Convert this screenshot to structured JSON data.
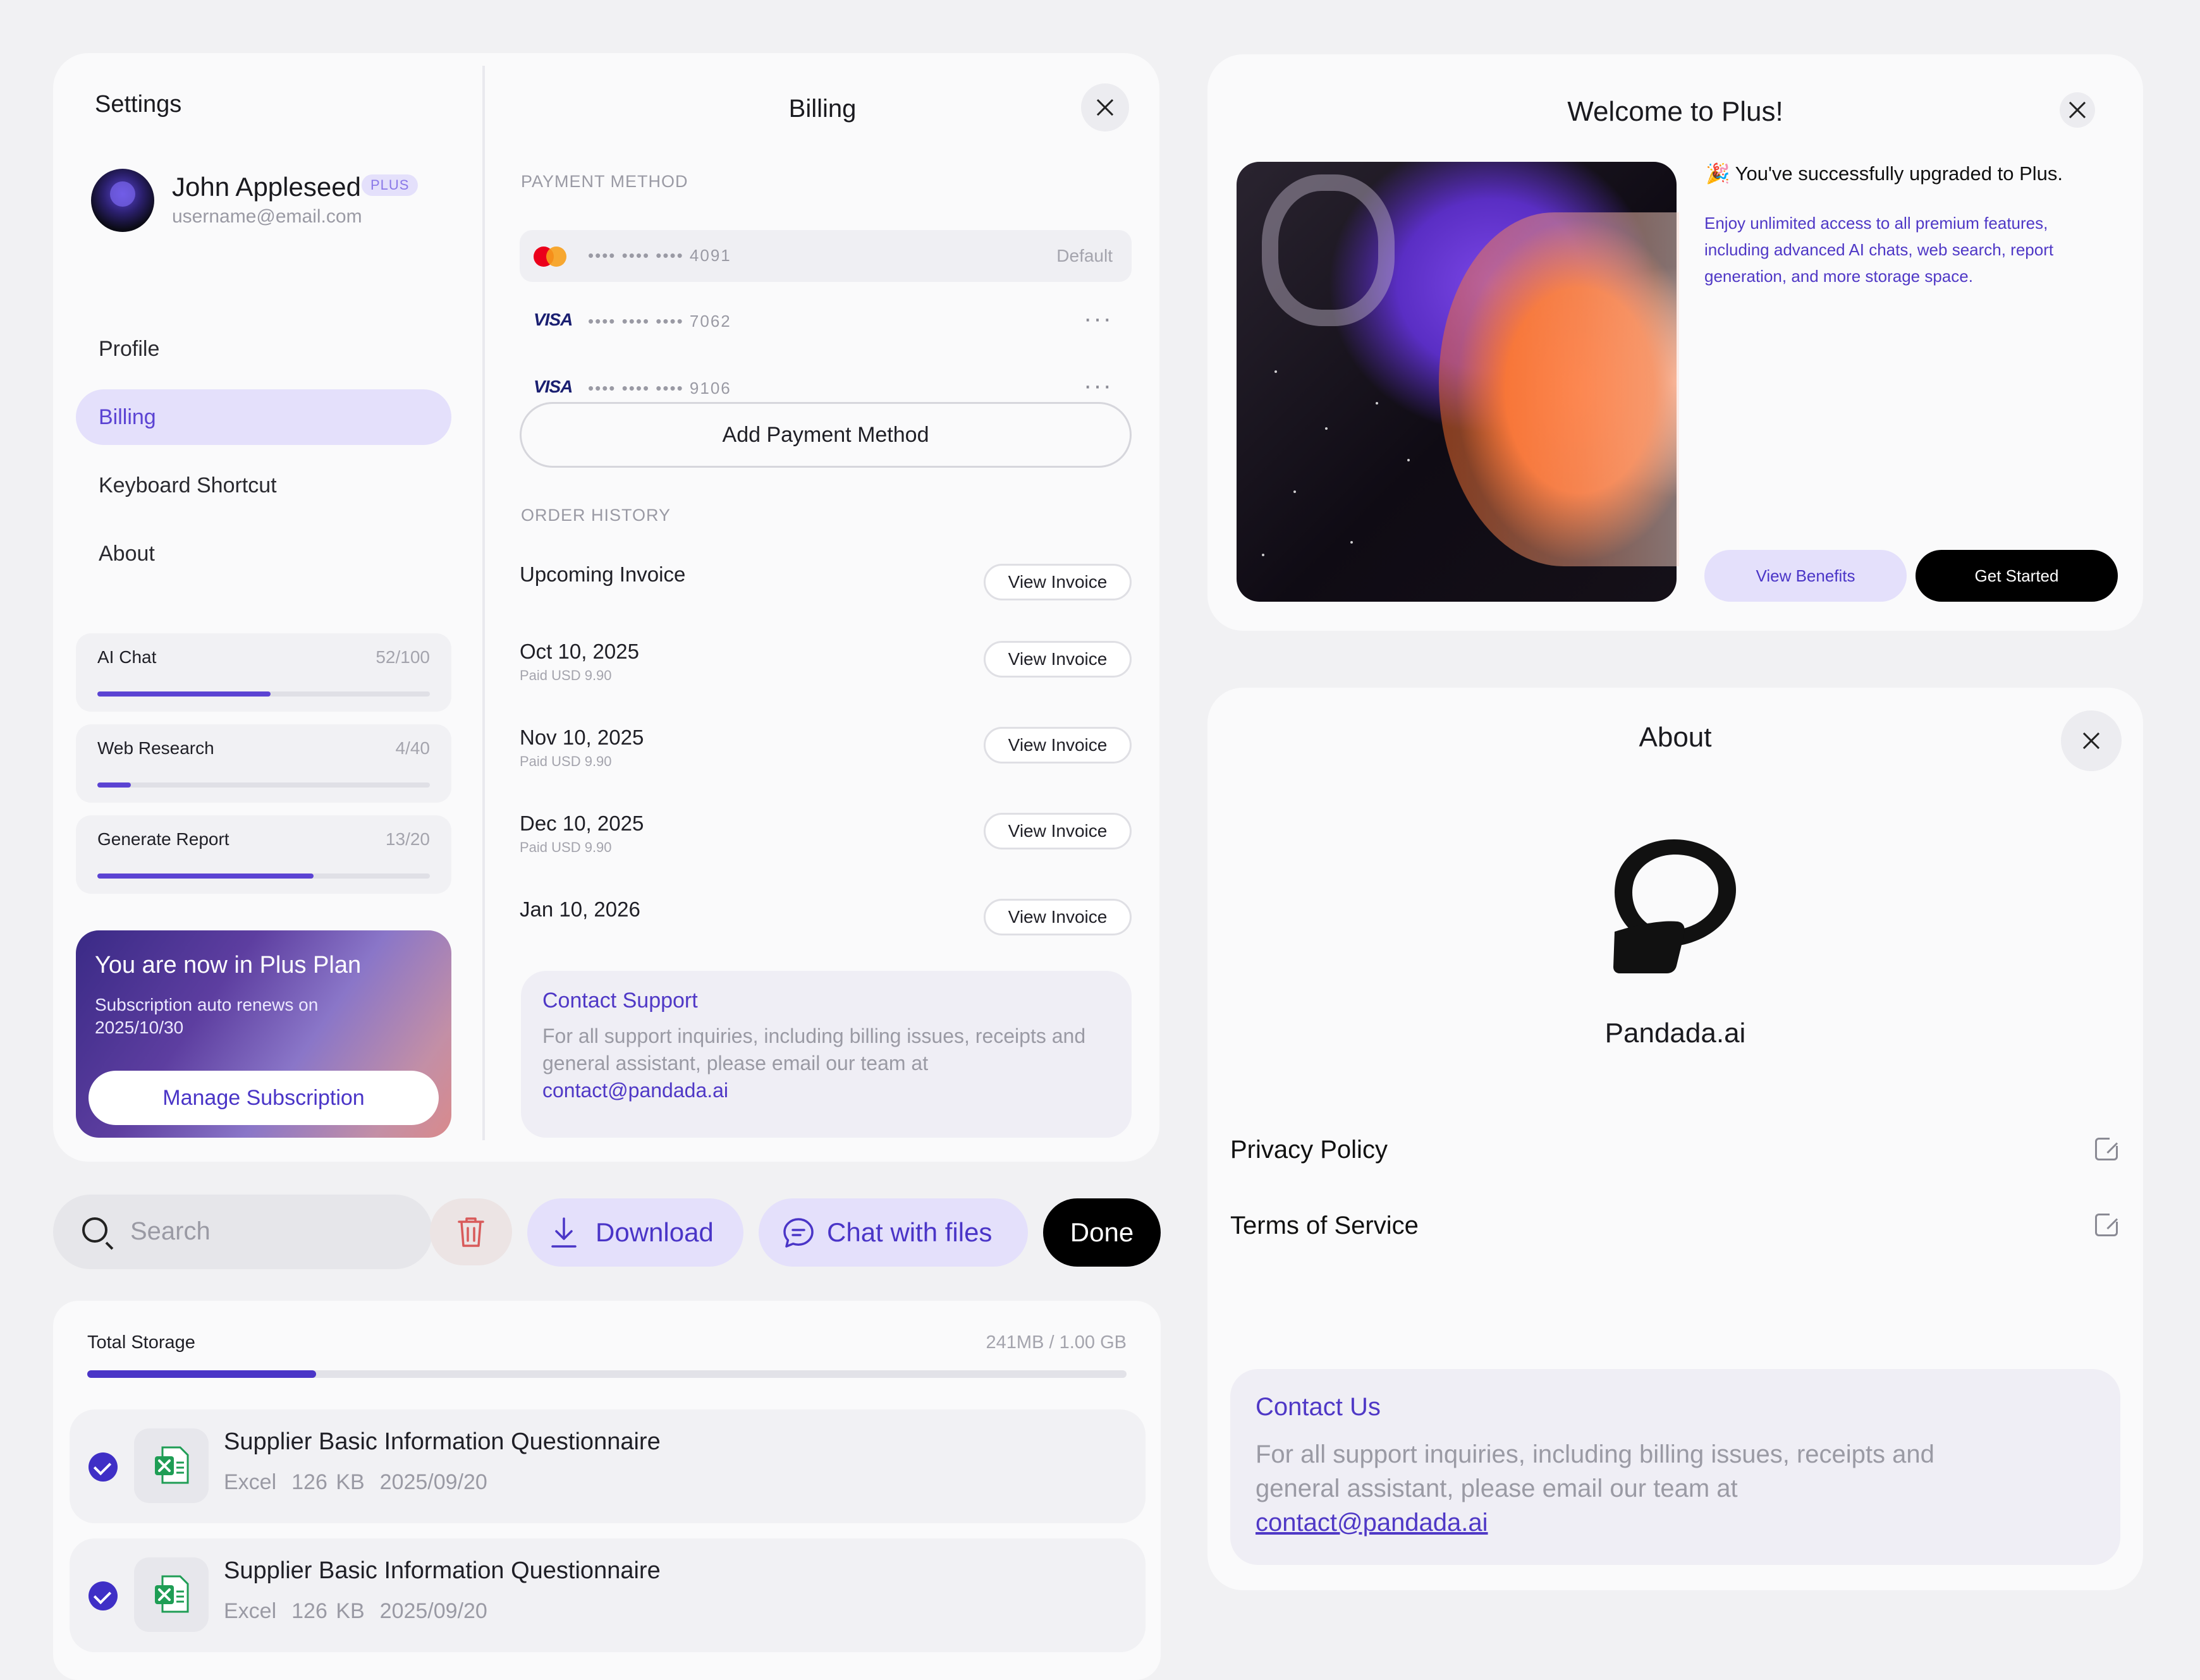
{
  "settings": {
    "title": "Settings",
    "user": {
      "name": "John Appleseed",
      "badge": "PLUS",
      "email": "username@email.com"
    },
    "nav": [
      {
        "label": "Profile",
        "active": false
      },
      {
        "label": "Billing",
        "active": true
      },
      {
        "label": "Keyboard Shortcut",
        "active": false
      },
      {
        "label": "About",
        "active": false
      }
    ],
    "usage": [
      {
        "label": "AI Chat",
        "count": "52/100",
        "progress": 0.52
      },
      {
        "label": "Web Research",
        "count": "4/40",
        "progress": 0.1
      },
      {
        "label": "Generate Report",
        "count": "13/20",
        "progress": 0.65
      }
    ],
    "plan": {
      "title": "You are now in Plus Plan",
      "subtitle": "Subscription auto renews on 2025/10/30",
      "button": "Manage Subscription"
    }
  },
  "billing": {
    "title": "Billing",
    "payment_label": "PAYMENT METHOD",
    "cards": [
      {
        "brand": "mastercard",
        "digits": "•••• •••• •••• 4091",
        "tag": "Default"
      },
      {
        "brand": "VISA",
        "digits": "•••• •••• •••• 7062",
        "more": "···"
      },
      {
        "brand": "VISA",
        "digits": "•••• •••• •••• 9106",
        "more": "···"
      }
    ],
    "add_payment": "Add Payment Method",
    "order_label": "ORDER HISTORY",
    "orders": [
      {
        "date": "Upcoming Invoice",
        "paid": "",
        "action": "View Invoice"
      },
      {
        "date": "Oct 10, 2025",
        "paid": "Paid USD 9.90",
        "action": "View Invoice"
      },
      {
        "date": "Nov 10, 2025",
        "paid": "Paid USD 9.90",
        "action": "View Invoice"
      },
      {
        "date": "Dec 10, 2025",
        "paid": "Paid USD 9.90",
        "action": "View Invoice"
      },
      {
        "date": "Jan 10, 2026",
        "paid": "",
        "action": "View Invoice"
      }
    ],
    "support": {
      "title": "Contact Support",
      "text": "For all support inquiries, including billing issues, receipts and general assistant, please email our team at",
      "email": "contact@pandada.ai"
    }
  },
  "toolbar": {
    "search_placeholder": "Search",
    "download": "Download",
    "chat_files": "Chat with files",
    "done": "Done"
  },
  "storage": {
    "title": "Total Storage",
    "amount": "241MB / 1.00 GB",
    "progress": 0.22,
    "files": [
      {
        "name": "Supplier Basic Information Questionnaire",
        "type": "Excel",
        "size": "126 KB",
        "date": "2025/09/20",
        "checked": true
      },
      {
        "name": "Supplier Basic Information Questionnaire",
        "type": "Excel",
        "size": "126 KB",
        "date": "2025/09/20",
        "checked": true
      }
    ]
  },
  "welcome": {
    "title": "Welcome to Plus!",
    "emoji": "🎉",
    "headline": "You've successfully upgraded to Plus.",
    "body": "Enjoy unlimited access to all premium features, including advanced AI chats, web search, report generation, and more storage space.",
    "benefits_button": "View Benefits",
    "start_button": "Get Started"
  },
  "about": {
    "title": "About",
    "brand": "Pandada.ai",
    "links": [
      {
        "label": "Privacy Policy"
      },
      {
        "label": "Terms of Service"
      }
    ],
    "contact": {
      "title": "Contact Us",
      "text": "For all support inquiries, including billing issues, receipts and general assistant, please email our team at",
      "email": "contact@pandada.ai"
    }
  },
  "colors": {
    "accent": "#4f38c6",
    "accent_soft": "#e4e0fb",
    "background": "#f1f1f3",
    "card": "#fafafb"
  }
}
